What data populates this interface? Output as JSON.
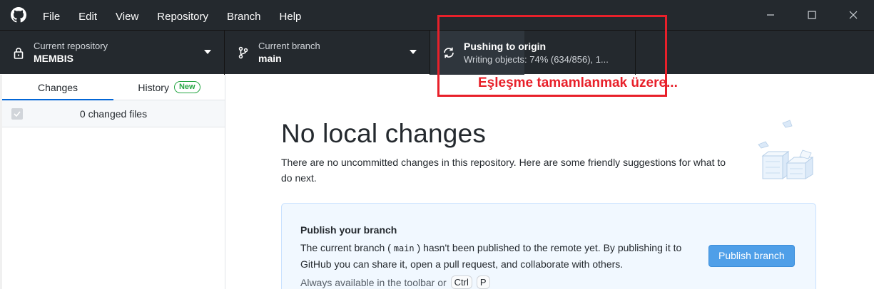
{
  "menu": {
    "items": [
      "File",
      "Edit",
      "View",
      "Repository",
      "Branch",
      "Help"
    ]
  },
  "toolbar": {
    "repo": {
      "label": "Current repository",
      "value": "MEMBIS"
    },
    "branch": {
      "label": "Current branch",
      "value": "main"
    },
    "push": {
      "value": "Pushing to origin",
      "desc": "Writing objects: 74% (634/856), 1...",
      "progress": 0.74
    }
  },
  "sidebar": {
    "tabs": {
      "changes": "Changes",
      "history": "History",
      "history_badge": "New"
    },
    "changes_count": "0 changed files"
  },
  "main": {
    "title": "No local changes",
    "description": "There are no uncommitted changes in this repository. Here are some friendly suggestions for what to do next.",
    "card": {
      "title": "Publish your branch",
      "text_before": "The current branch ( ",
      "branch_code": "main",
      "text_after": " ) hasn't been published to the remote yet. By publishing it to GitHub you can share it, open a pull request, and collaborate with others.",
      "hint": "Always available in the toolbar or",
      "key1": "Ctrl",
      "key2": "P",
      "button": "Publish branch"
    }
  },
  "annotation": {
    "text": "Eşleşme tamamlanmak üzere...",
    "color": "#e8202a"
  },
  "colors": {
    "toolbar_bg": "#24292e",
    "accent": "#0366d6",
    "badge_green": "#28a745",
    "button_blue": "#4f9fe8"
  }
}
